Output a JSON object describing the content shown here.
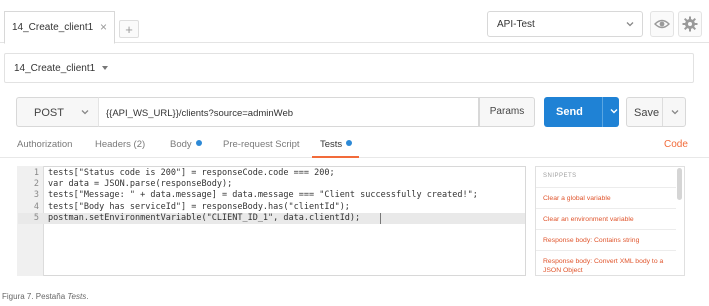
{
  "tabs": [
    {
      "label": "14_Create_client1",
      "close": "×"
    }
  ],
  "new_tab_label": "+",
  "environment": {
    "selected": "API-Test"
  },
  "request_name": "14_Create_client1",
  "request": {
    "method": "POST",
    "url": "{{API_WS_URL}}/clients?source=adminWeb",
    "params_label": "Params",
    "send_label": "Send",
    "save_label": "Save"
  },
  "subtabs": [
    {
      "label": "Authorization"
    },
    {
      "label": "Headers (2)"
    },
    {
      "label": "Body"
    },
    {
      "label": "Pre-request Script"
    },
    {
      "label": "Tests"
    }
  ],
  "code_link": "Code",
  "editor": {
    "line_numbers": [
      "1",
      "2",
      "3",
      "4",
      "5"
    ],
    "lines": [
      "tests[\"Status code is 200\"] = responseCode.code === 200;",
      "var data = JSON.parse(responseBody);",
      "tests[\"Message: \" + data.message] = data.message === \"Client successfully created!\";",
      "tests[\"Body has serviceId\"] = responseBody.has(\"clientId\");",
      "postman.setEnvironmentVariable(\"CLIENT_ID_1\", data.clientId);"
    ]
  },
  "snippets": {
    "title": "SNIPPETS",
    "items": [
      "Clear a global variable",
      "Clear an environment variable",
      "Response body: Contains string",
      "Response body: Convert XML body to a JSON Object"
    ]
  },
  "caption": {
    "prefix": "Figura 7. Pestaña ",
    "emph": "Tests",
    "suffix": "."
  },
  "colors": {
    "accent": "#f26b3a",
    "send": "#1f82d5",
    "link": "#e0552d"
  }
}
